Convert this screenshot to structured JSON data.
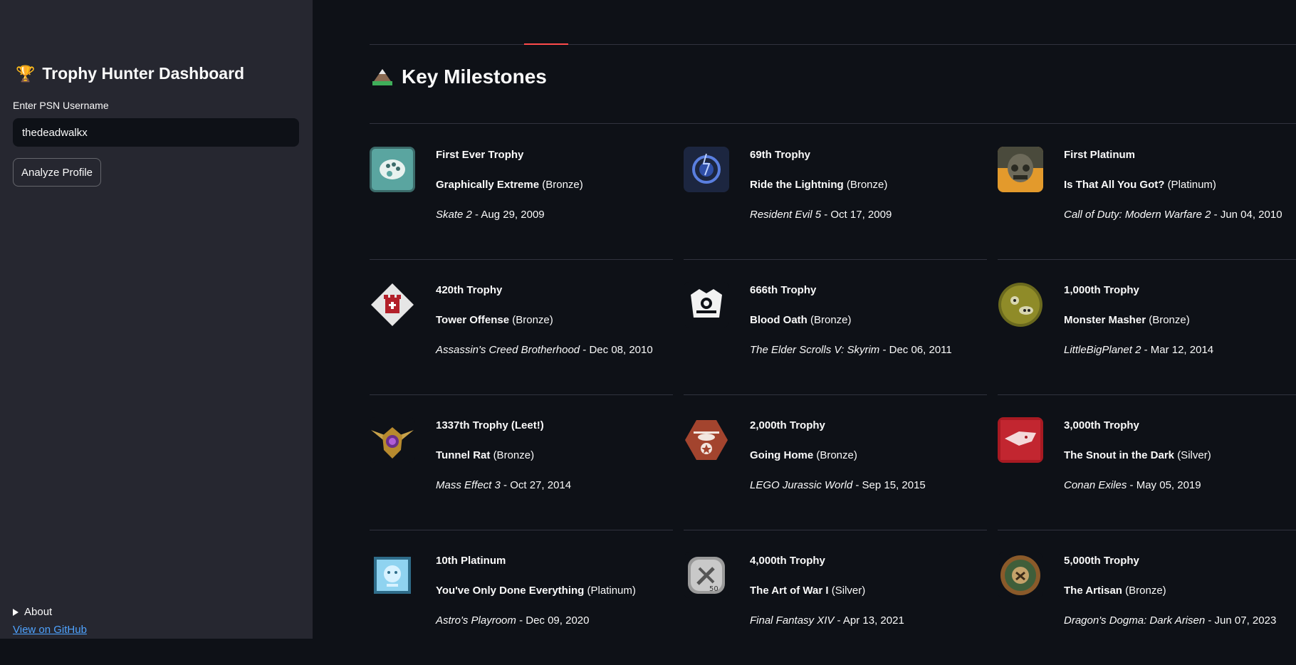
{
  "sidebar": {
    "title": "Trophy Hunter Dashboard",
    "username_label": "Enter PSN Username",
    "username_value": "thedeadwalkx",
    "analyze_button": "Analyze Profile",
    "about_label": "About",
    "github_link": "View on GitHub"
  },
  "main": {
    "title": "Key Milestones",
    "milestones": [
      {
        "milestone": "First Ever Trophy",
        "trophy": "Graphically Extreme",
        "grade": "(Bronze)",
        "game": "Skate 2",
        "date": " - Aug 29, 2009",
        "icon": "palette-icon"
      },
      {
        "milestone": "69th Trophy",
        "trophy": "Ride the Lightning",
        "grade": "(Bronze)",
        "game": "Resident Evil 5",
        "date": " - Oct 17, 2009",
        "icon": "lightning-ring-icon"
      },
      {
        "milestone": "First Platinum",
        "trophy": "Is That All You Got?",
        "grade": "(Platinum)",
        "game": "Call of Duty: Modern Warfare 2",
        "date": " - Jun 04, 2010",
        "icon": "soldier-mask-icon"
      },
      {
        "milestone": "420th Trophy",
        "trophy": "Tower Offense",
        "grade": "(Bronze)",
        "game": "Assassin's Creed Brotherhood",
        "date": " - Dec 08, 2010",
        "icon": "tower-icon"
      },
      {
        "milestone": "666th Trophy",
        "trophy": "Blood Oath",
        "grade": "(Bronze)",
        "game": "The Elder Scrolls V: Skyrim",
        "date": " - Dec 06, 2011",
        "icon": "dark-brotherhood-icon"
      },
      {
        "milestone": "1,000th Trophy",
        "trophy": "Monster Masher",
        "grade": "(Bronze)",
        "game": "LittleBigPlanet 2",
        "date": " - Mar 12, 2014",
        "icon": "monster-face-icon"
      },
      {
        "milestone": "1337th Trophy (Leet!)",
        "trophy": "Tunnel Rat",
        "grade": "(Bronze)",
        "game": "Mass Effect 3",
        "date": " - Oct 27, 2014",
        "icon": "winged-medal-icon"
      },
      {
        "milestone": "2,000th Trophy",
        "trophy": "Going Home",
        "grade": "(Bronze)",
        "game": "LEGO Jurassic World",
        "date": " - Sep 15, 2015",
        "icon": "helicopter-badge-icon"
      },
      {
        "milestone": "3,000th Trophy",
        "trophy": "The Snout in the Dark",
        "grade": "(Silver)",
        "game": "Conan Exiles",
        "date": " - May 05, 2019",
        "icon": "red-beast-icon"
      },
      {
        "milestone": "10th Platinum",
        "trophy": "You've Only Done Everything",
        "grade": "(Platinum)",
        "game": "Astro's Playroom",
        "date": " - Dec 09, 2020",
        "icon": "chip-icon"
      },
      {
        "milestone": "4,000th Trophy",
        "trophy": "The Art of War I",
        "grade": "(Silver)",
        "game": "Final Fantasy XIV",
        "date": " - Apr 13, 2021",
        "icon": "tools-50-icon"
      },
      {
        "milestone": "5,000th Trophy",
        "trophy": "The Artisan",
        "grade": "(Bronze)",
        "game": "Dragon's Dogma: Dark Arisen",
        "date": " - Jun 07, 2023",
        "icon": "artisan-wreath-icon"
      }
    ]
  },
  "colors": {
    "sidebar_bg": "#262730",
    "main_bg": "#0e1117",
    "accent": "#ff4b4b",
    "link": "#4fa3ff"
  }
}
